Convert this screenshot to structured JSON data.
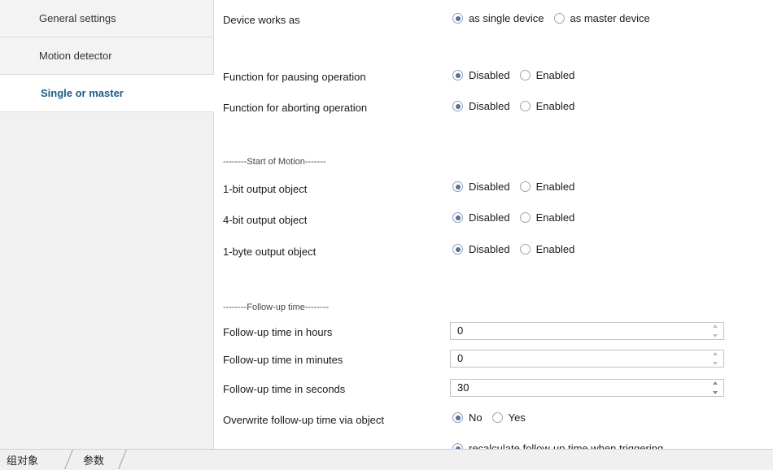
{
  "sidebar": {
    "items": [
      {
        "label": "General settings"
      },
      {
        "label": "Motion detector"
      },
      {
        "label": "Single or master"
      }
    ]
  },
  "params": {
    "device_works_as": {
      "label": "Device works as",
      "options": [
        "as single device",
        "as master device"
      ],
      "selected": 0
    },
    "pausing": {
      "label": "Function for pausing operation",
      "options": [
        "Disabled",
        "Enabled"
      ],
      "selected": 0
    },
    "aborting": {
      "label": "Function for aborting operation",
      "options": [
        "Disabled",
        "Enabled"
      ],
      "selected": 0
    },
    "section_start": "--------Start of Motion-------",
    "bit1_output": {
      "label": "1-bit output object",
      "options": [
        "Disabled",
        "Enabled"
      ],
      "selected": 0
    },
    "bit4_output": {
      "label": "4-bit output object",
      "options": [
        "Disabled",
        "Enabled"
      ],
      "selected": 0
    },
    "byte1_output": {
      "label": "1-byte output object",
      "options": [
        "Disabled",
        "Enabled"
      ],
      "selected": 0
    },
    "section_followup": "--------Follow-up time--------",
    "followup_hours": {
      "label": "Follow-up time in hours",
      "value": "0"
    },
    "followup_minutes": {
      "label": "Follow-up time in minutes",
      "value": "0"
    },
    "followup_seconds": {
      "label": "Follow-up time in seconds",
      "value": "30"
    },
    "overwrite": {
      "label": "Overwrite follow-up time via object",
      "options": [
        "No",
        "Yes"
      ],
      "selected": 0
    },
    "recalc": {
      "option": "recalculate follow-up time when triggering"
    }
  },
  "tabs": [
    {
      "label": "组对象"
    },
    {
      "label": "参数"
    }
  ],
  "colors": {
    "active_sidebar_text": "#1c5d8c",
    "radio_dot": "#5a6e90"
  }
}
